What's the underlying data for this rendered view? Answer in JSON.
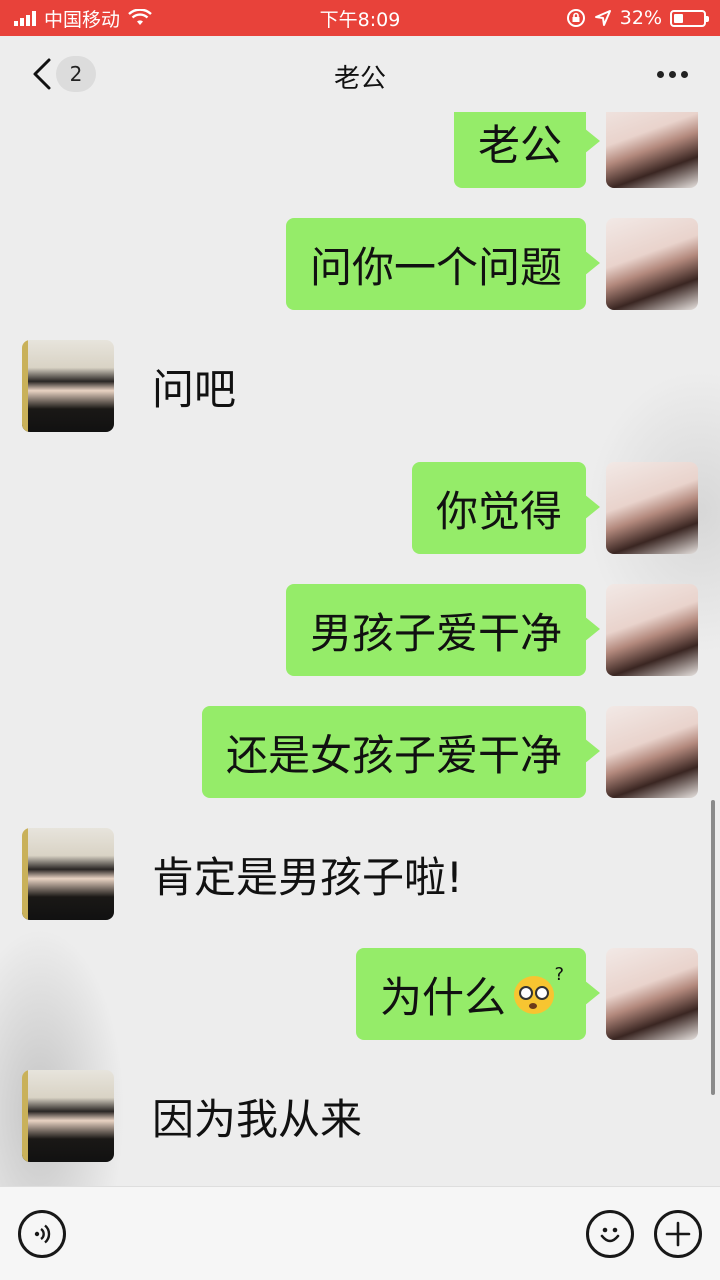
{
  "status_bar": {
    "carrier": "中国移动",
    "time": "下午8:09",
    "battery": "32%",
    "battery_level": 0.32
  },
  "nav": {
    "unread_count": "2",
    "title": "老公"
  },
  "messages": [
    {
      "side": "out",
      "text": "老公"
    },
    {
      "side": "out",
      "text": "问你一个问题"
    },
    {
      "side": "in",
      "text": "问吧"
    },
    {
      "side": "out",
      "text": "你觉得"
    },
    {
      "side": "out",
      "text": "男孩子爱干净"
    },
    {
      "side": "out",
      "text": "还是女孩子爱干净"
    },
    {
      "side": "in",
      "text": "肯定是男孩子啦!"
    },
    {
      "side": "out",
      "text": "为什么",
      "emoji": "dizzy-face-emoji"
    },
    {
      "side": "in",
      "text": "因为我从来"
    }
  ],
  "input_bar": {
    "left_icon": "voice-icon",
    "right_icons": [
      "emoji-icon",
      "plus-icon"
    ]
  }
}
